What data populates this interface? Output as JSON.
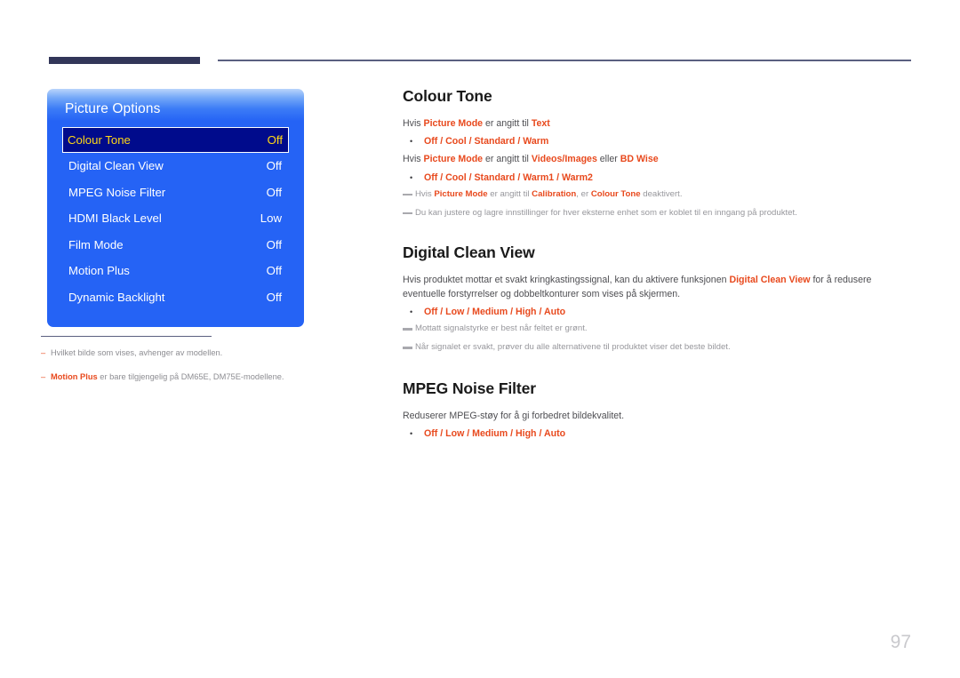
{
  "page": {
    "number": "97"
  },
  "osd": {
    "title": "Picture Options",
    "rows": [
      {
        "label": "Colour Tone",
        "value": "Off",
        "selected": true
      },
      {
        "label": "Digital Clean View",
        "value": "Off",
        "selected": false
      },
      {
        "label": "MPEG Noise Filter",
        "value": "Off",
        "selected": false
      },
      {
        "label": "HDMI Black Level",
        "value": "Low",
        "selected": false
      },
      {
        "label": "Film Mode",
        "value": "Off",
        "selected": false
      },
      {
        "label": "Motion Plus",
        "value": "Off",
        "selected": false
      },
      {
        "label": "Dynamic Backlight",
        "value": "Off",
        "selected": false
      }
    ]
  },
  "left_notes": {
    "dash": "–",
    "note1": "Hvilket bilde som vises, avhenger av modellen.",
    "note2_bold": "Motion Plus",
    "note2_rest": " er bare tilgjengelig på DM65E, DM75E-modellene."
  },
  "sections": {
    "colour_tone": {
      "heading": "Colour Tone",
      "line1_a": "Hvis ",
      "line1_b": "Picture Mode",
      "line1_c": " er angitt til ",
      "line1_d": "Text",
      "options1": "Off / Cool / Standard / Warm",
      "line2_a": "Hvis ",
      "line2_b": "Picture Mode",
      "line2_c": " er angitt til ",
      "line2_d": "Videos/Images",
      "line2_e": " eller ",
      "line2_f": "BD Wise",
      "options2": "Off / Cool / Standard / Warm1 / Warm2",
      "note1_a": "Hvis ",
      "note1_b": "Picture Mode",
      "note1_c": " er angitt til ",
      "note1_d": "Calibration",
      "note1_e": ", er ",
      "note1_f": "Colour Tone",
      "note1_g": " deaktivert.",
      "note2": "Du kan justere og lagre innstillinger for hver eksterne enhet som er koblet til en inngang på produktet."
    },
    "digital_clean_view": {
      "heading": "Digital Clean View",
      "body_a": "Hvis produktet mottar et svakt kringkastingssignal, kan du aktivere funksjonen ",
      "body_b": "Digital Clean View",
      "body_c": " for å redusere eventuelle forstyrrelser og dobbeltkonturer som vises på skjermen.",
      "options": "Off / Low / Medium / High / Auto",
      "note1": "Mottatt signalstyrke er best når feltet er grønt.",
      "note2": "Når signalet er svakt, prøver du alle alternativene til produktet viser det beste bildet."
    },
    "mpeg_noise_filter": {
      "heading": "MPEG Noise Filter",
      "body": "Reduserer MPEG-støy for å gi forbedret bildekvalitet.",
      "options": "Off / Low / Medium / High / Auto"
    }
  },
  "icons": {
    "bullet": "•"
  },
  "colors": {
    "accent_red": "#e8491d",
    "osd_blue": "#2563f5",
    "osd_selected_navy": "#000b8c",
    "osd_selected_text": "#ffd814",
    "rule_navy": "#323659"
  }
}
